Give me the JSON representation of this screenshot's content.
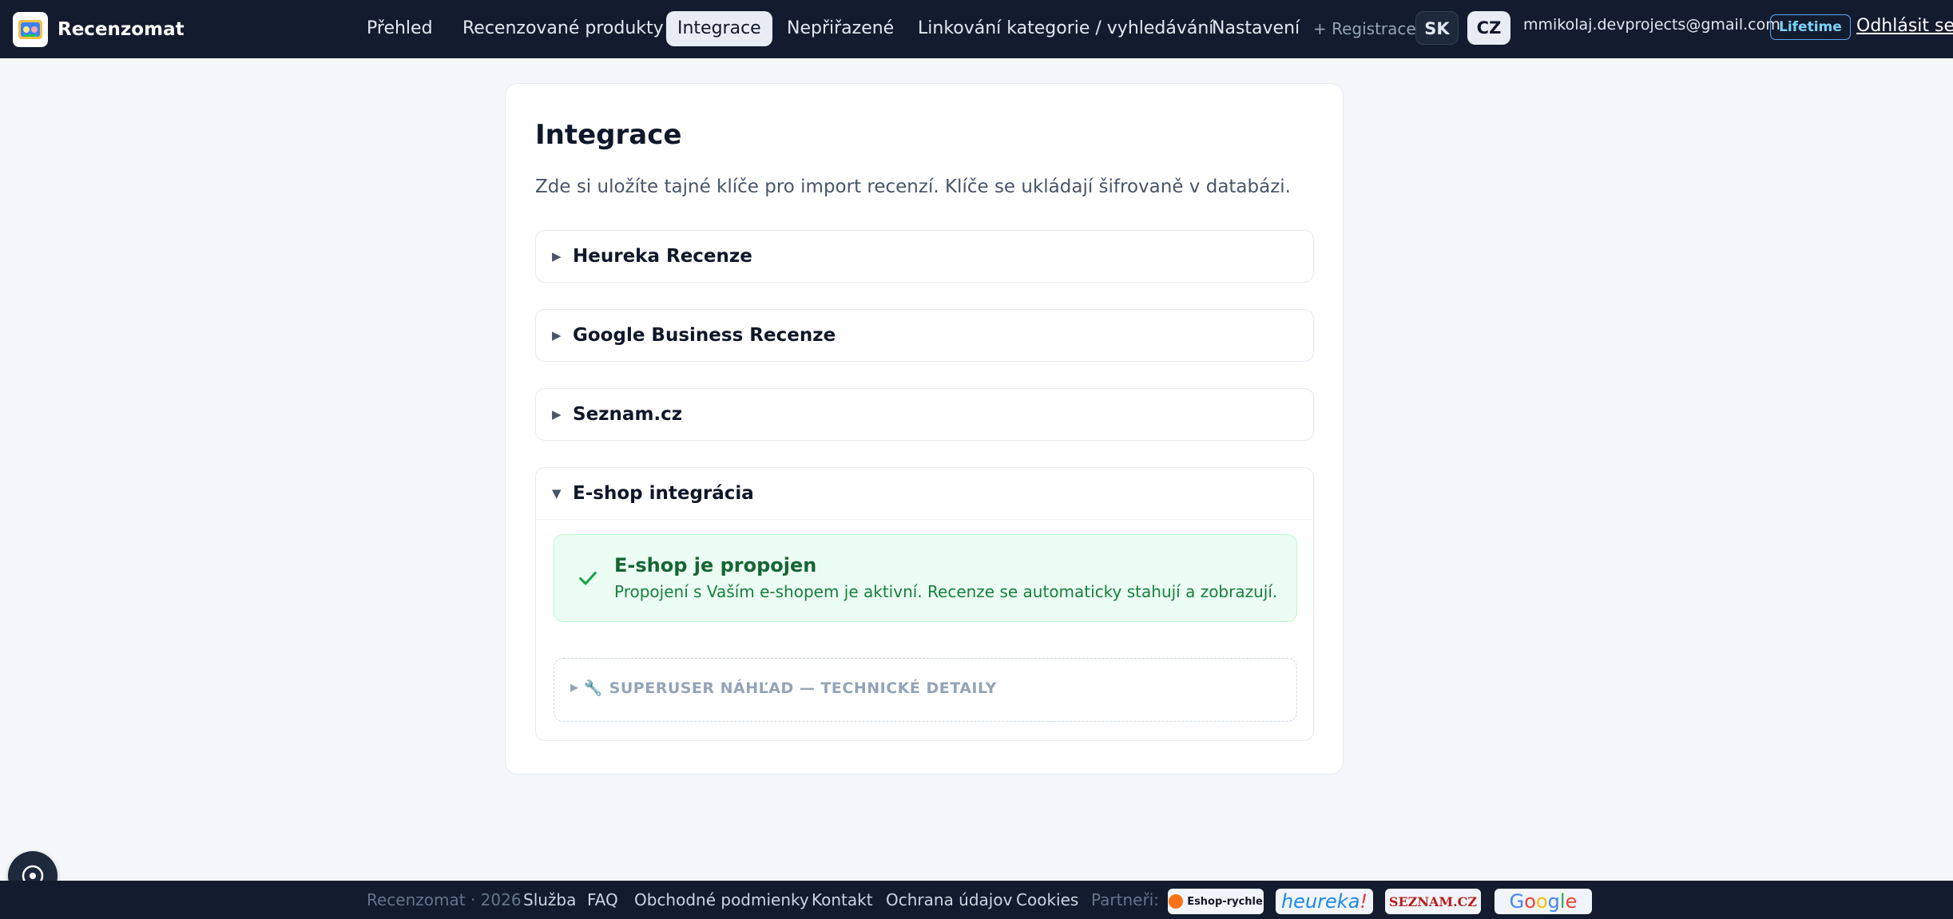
{
  "brand": {
    "name": "Recenzomat"
  },
  "nav": {
    "links": [
      {
        "label": "Přehled"
      },
      {
        "label": "Recenzované produkty"
      },
      {
        "label": "Integrace"
      },
      {
        "label": "Nepřiřazené"
      },
      {
        "label": "Linkování kategorie / vyhledávání"
      },
      {
        "label": "Nastavení"
      }
    ],
    "register": "+ Registrace",
    "lang_sk": "SK",
    "lang_cz": "CZ",
    "user_email": "mmikolaj.devprojects@gmail.com",
    "plan_badge": "Lifetime",
    "logout": "Odhlásit se"
  },
  "page": {
    "title": "Integrace",
    "description": "Zde si uložíte tajné klíče pro import recenzí. Klíče se ukládají šifrovaně v databázi."
  },
  "accordions": [
    {
      "title": "Heureka Recenze"
    },
    {
      "title": "Google Business Recenze"
    },
    {
      "title": "Seznam.cz"
    },
    {
      "title": "E-shop integrácia"
    }
  ],
  "eshop_status": {
    "title": "E-shop je propojen",
    "text": "Propojení s Vaším e-shopem je aktivní. Recenze se automaticky stahují a zobrazují."
  },
  "superuser": {
    "label": "SUPERUSER NÁHĽAD — TECHNICKÉ DETAILY"
  },
  "footer": {
    "copyright": "Recenzomat · 2026",
    "links": [
      "Služba",
      "FAQ",
      "Obchodné podmienky",
      "Kontakt",
      "Ochrana údajov",
      "Cookies"
    ],
    "partners_label": "Partneři:",
    "partners": {
      "eshop": "Eshop-rychle",
      "heureka": "heureka",
      "heureka_mark": "!",
      "seznam": "SEZNAM.CZ",
      "google": [
        "G",
        "o",
        "o",
        "g",
        "l",
        "e"
      ]
    }
  },
  "colors": {
    "topbar": "#131c2e",
    "success_bg": "#ecfdf3",
    "success_text": "#166534",
    "badge_border": "#60a5fa"
  }
}
